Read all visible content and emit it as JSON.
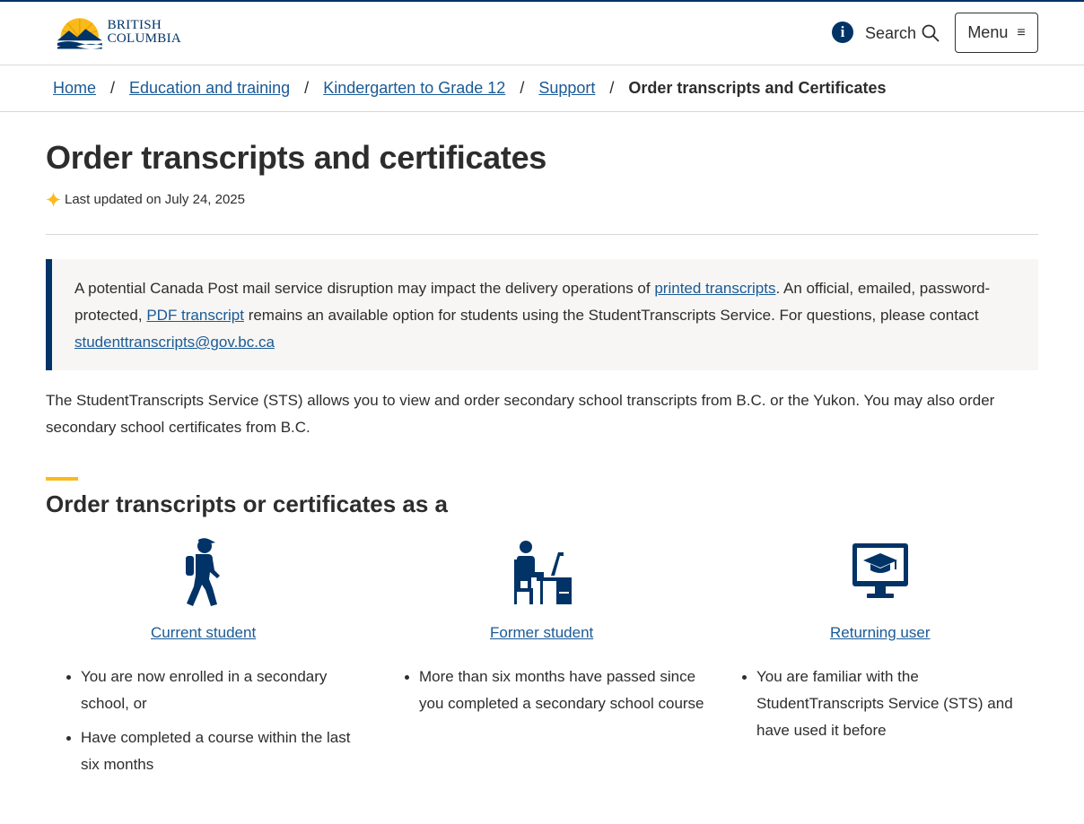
{
  "colors": {
    "primary": "#013366",
    "link": "#1a5a96",
    "accent": "#fcba19",
    "text": "#2d2d2d",
    "notice_bg": "#f7f6f4"
  },
  "header": {
    "logo_line1": "BRITISH",
    "logo_line2": "COLUMBIA",
    "info_icon": "info-icon",
    "search_label": "Search",
    "menu_label": "Menu",
    "menu_icon": "≡"
  },
  "breadcrumb": {
    "items": [
      {
        "label": "Home"
      },
      {
        "label": "Education and training"
      },
      {
        "label": "Kindergarten to Grade 12"
      },
      {
        "label": "Support"
      }
    ],
    "separator": "/",
    "current": "Order transcripts and Certificates"
  },
  "page": {
    "title": "Order transcripts and certificates",
    "updated": "Last updated on July 24, 2025"
  },
  "notice": {
    "t1": "A potential Canada Post mail service disruption may impact the delivery operations of ",
    "link1": "printed transcripts",
    "t2": ". An official, emailed, password-protected, ",
    "link2": "PDF transcript",
    "t3": " remains an available option for students using the StudentTranscripts Service. For questions, please contact ",
    "email": "studenttranscripts@gov.bc.ca"
  },
  "intro": "The StudentTranscripts Service (STS) allows you to view and order secondary school transcripts from B.C. or the Yukon. You may also order secondary school certificates from B.C.",
  "section": {
    "title": "Order transcripts or certificates as a"
  },
  "cards": [
    {
      "icon": "walking-student-icon",
      "link": "Current student",
      "bullets": [
        "You are now enrolled in a secondary school, or",
        "Have completed a course within the last six months"
      ]
    },
    {
      "icon": "desk-student-icon",
      "link": "Former student",
      "bullets": [
        "More than six months have passed since you completed a secondary school course"
      ]
    },
    {
      "icon": "monitor-graduation-icon",
      "link": "Returning user",
      "bullets": [
        "You are familiar with the StudentTranscripts Service (STS) and have used it before"
      ]
    }
  ]
}
